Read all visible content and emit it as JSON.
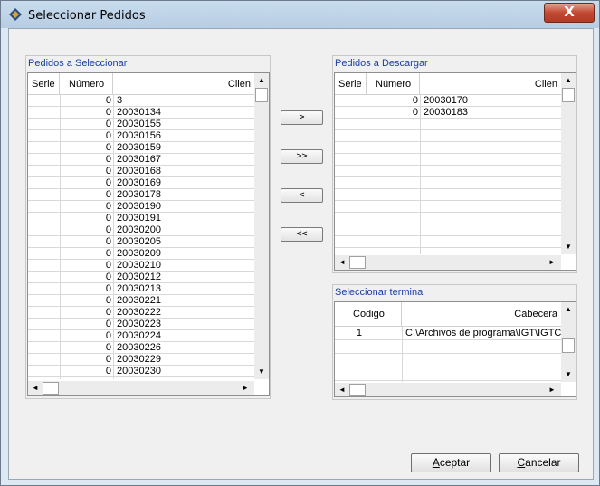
{
  "window": {
    "title": "Seleccionar Pedidos",
    "close_label": "X"
  },
  "left_panel": {
    "title": "Pedidos a Seleccionar",
    "columns": [
      "Serie",
      "Número",
      "Clien"
    ],
    "rows": [
      {
        "serie": "",
        "numero": "0",
        "cliente": "3"
      },
      {
        "serie": "",
        "numero": "0",
        "cliente": "20030134"
      },
      {
        "serie": "",
        "numero": "0",
        "cliente": "20030155"
      },
      {
        "serie": "",
        "numero": "0",
        "cliente": "20030156"
      },
      {
        "serie": "",
        "numero": "0",
        "cliente": "20030159"
      },
      {
        "serie": "",
        "numero": "0",
        "cliente": "20030167"
      },
      {
        "serie": "",
        "numero": "0",
        "cliente": "20030168"
      },
      {
        "serie": "",
        "numero": "0",
        "cliente": "20030169"
      },
      {
        "serie": "",
        "numero": "0",
        "cliente": "20030178"
      },
      {
        "serie": "",
        "numero": "0",
        "cliente": "20030190"
      },
      {
        "serie": "",
        "numero": "0",
        "cliente": "20030191"
      },
      {
        "serie": "",
        "numero": "0",
        "cliente": "20030200"
      },
      {
        "serie": "",
        "numero": "0",
        "cliente": "20030205"
      },
      {
        "serie": "",
        "numero": "0",
        "cliente": "20030209"
      },
      {
        "serie": "",
        "numero": "0",
        "cliente": "20030210"
      },
      {
        "serie": "",
        "numero": "0",
        "cliente": "20030212"
      },
      {
        "serie": "",
        "numero": "0",
        "cliente": "20030213"
      },
      {
        "serie": "",
        "numero": "0",
        "cliente": "20030221"
      },
      {
        "serie": "",
        "numero": "0",
        "cliente": "20030222"
      },
      {
        "serie": "",
        "numero": "0",
        "cliente": "20030223"
      },
      {
        "serie": "",
        "numero": "0",
        "cliente": "20030224"
      },
      {
        "serie": "",
        "numero": "0",
        "cliente": "20030226"
      },
      {
        "serie": "",
        "numero": "0",
        "cliente": "20030229"
      },
      {
        "serie": "",
        "numero": "0",
        "cliente": "20030230"
      }
    ]
  },
  "transfer_buttons": {
    "add_one": ">",
    "add_all": ">>",
    "remove_one": "<",
    "remove_all": "<<"
  },
  "right_panel": {
    "title": "Pedidos a Descargar",
    "columns": [
      "Serie",
      "Número",
      "Clien"
    ],
    "rows": [
      {
        "serie": "",
        "numero": "0",
        "cliente": "20030170"
      },
      {
        "serie": "",
        "numero": "0",
        "cliente": "20030183"
      }
    ]
  },
  "terminal_panel": {
    "title": "Seleccionar terminal",
    "columns": [
      "Codigo",
      "Cabecera"
    ],
    "rows": [
      {
        "codigo": "1",
        "cabecera": "C:\\Archivos de programa\\IGT\\IGTCr"
      }
    ]
  },
  "footer": {
    "accept_label": "Aceptar",
    "accept_rest": "ceptar",
    "accept_key": "A",
    "cancel_label": "Cancelar",
    "cancel_rest": "ancelar",
    "cancel_key": "C"
  },
  "icons": {
    "scroll_up": "▲",
    "scroll_down": "▼",
    "scroll_left": "◄",
    "scroll_right": "►"
  }
}
